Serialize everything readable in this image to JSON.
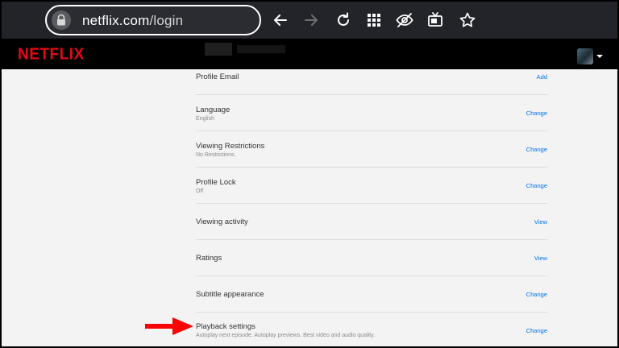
{
  "browser": {
    "url_domain": "netflix.com",
    "url_path": "/login"
  },
  "netflix": {
    "logo": "NETFLIX"
  },
  "rows": [
    {
      "title": "Profile Email",
      "subtitle": "",
      "action": "Add"
    },
    {
      "title": "Language",
      "subtitle": "English",
      "action": "Change"
    },
    {
      "title": "Viewing Restrictions",
      "subtitle": "No Restrictions.",
      "action": "Change"
    },
    {
      "title": "Profile Lock",
      "subtitle": "Off",
      "action": "Change"
    },
    {
      "title": "Viewing activity",
      "subtitle": "",
      "action": "View"
    },
    {
      "title": "Ratings",
      "subtitle": "",
      "action": "View"
    },
    {
      "title": "Subtitle appearance",
      "subtitle": "",
      "action": "Change"
    },
    {
      "title": "Playback settings",
      "subtitle": "Autoplay next episode. Autoplay previews. Best video and audio quality.",
      "action": "Change"
    }
  ],
  "colors": {
    "netflix_red": "#e50914",
    "link_blue": "#0071eb",
    "annotation_arrow": "#ff0000"
  },
  "icons": [
    "lock-icon",
    "back-arrow-icon",
    "forward-arrow-icon",
    "refresh-icon",
    "apps-grid-icon",
    "eye-off-icon",
    "tv-icon",
    "star-icon",
    "dropdown-caret-icon"
  ]
}
